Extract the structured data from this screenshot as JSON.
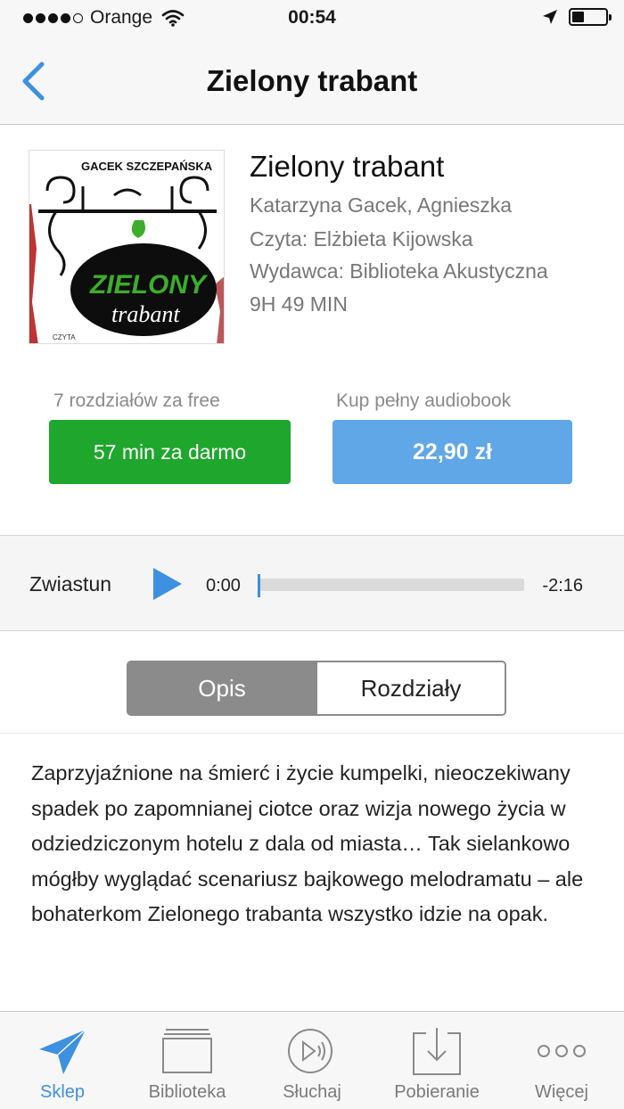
{
  "status_bar": {
    "carrier": "Orange",
    "time": "00:54",
    "icons": [
      "signal-dots-icon",
      "wifi-icon",
      "location-arrow-icon",
      "battery-icon"
    ]
  },
  "nav": {
    "title": "Zielony trabant",
    "back_icon": "chevron-left-icon"
  },
  "book": {
    "title": "Zielony trabant",
    "authors": "Katarzyna Gacek, Agnieszka",
    "narrator": "Czyta: Elżbieta Kijowska",
    "publisher": "Wydawca: Biblioteka Akustyczna",
    "duration": "9H 49 MIN",
    "cover": {
      "authors_text": "GACEK SZCZEPAŃSKA",
      "title_top": "ZIELONY",
      "title_bottom": "trabant",
      "small_text": "CZYTA"
    }
  },
  "offers": {
    "free_label": "7 rozdziałów za free",
    "free_button": "57 min za darmo",
    "buy_label": "Kup pełny audiobook",
    "buy_button": "22,90 zł",
    "colors": {
      "free": "#1fa62d",
      "buy": "#5fa7e6"
    }
  },
  "trailer": {
    "label": "Zwiastun",
    "current_time": "0:00",
    "remaining_time": "-2:16",
    "progress_fraction": 0.0
  },
  "segments": {
    "active": "Opis",
    "inactive": "Rozdziały"
  },
  "description": "Zaprzyjaźnione na śmierć i życie kumpelki, nieoczekiwany spadek po zapomnianej ciotce oraz wizja nowego życia w odziedziczonym hotelu z dala od miasta… Tak sielankowo mógłby wyglądać scenariusz bajkowego melodramatu – ale bohaterkom Zielonego trabanta wszystko idzie na opak.",
  "tabs": [
    {
      "label": "Sklep",
      "icon": "paper-plane-icon",
      "active": true
    },
    {
      "label": "Biblioteka",
      "icon": "library-icon",
      "active": false
    },
    {
      "label": "Słuchaj",
      "icon": "listen-play-icon",
      "active": false
    },
    {
      "label": "Pobieranie",
      "icon": "download-icon",
      "active": false
    },
    {
      "label": "Więcej",
      "icon": "more-dots-icon",
      "active": false
    }
  ],
  "accent_color": "#3e90e0"
}
